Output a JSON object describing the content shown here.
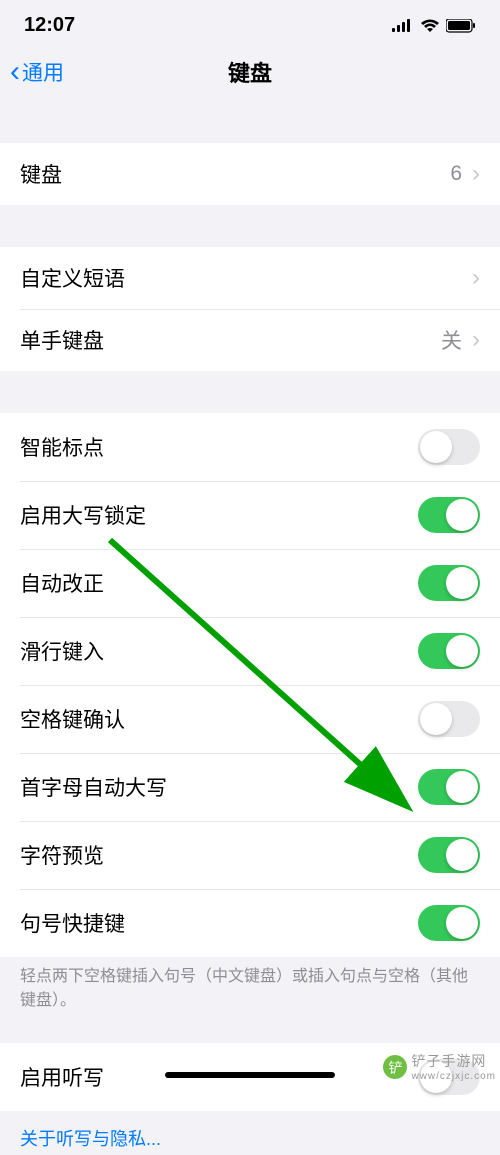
{
  "status": {
    "time": "12:07"
  },
  "nav": {
    "back": "通用",
    "title": "键盘"
  },
  "rows": {
    "keyboards": {
      "label": "键盘",
      "value": "6"
    },
    "phrases": {
      "label": "自定义短语"
    },
    "oneHand": {
      "label": "单手键盘",
      "value": "关"
    }
  },
  "toggles": [
    {
      "label": "智能标点",
      "on": false
    },
    {
      "label": "启用大写锁定",
      "on": true
    },
    {
      "label": "自动改正",
      "on": true
    },
    {
      "label": "滑行键入",
      "on": true
    },
    {
      "label": "空格键确认",
      "on": false
    },
    {
      "label": "首字母自动大写",
      "on": true
    },
    {
      "label": "字符预览",
      "on": true
    },
    {
      "label": "句号快捷键",
      "on": true
    }
  ],
  "footer": "轻点两下空格键插入句号（中文键盘）或插入句点与空格（其他键盘）。",
  "dictation": {
    "label": "启用听写",
    "on": false,
    "link": "关于听写与隐私..."
  },
  "watermark": {
    "text": "铲子手游网",
    "url": "www/czjxjc.com"
  }
}
